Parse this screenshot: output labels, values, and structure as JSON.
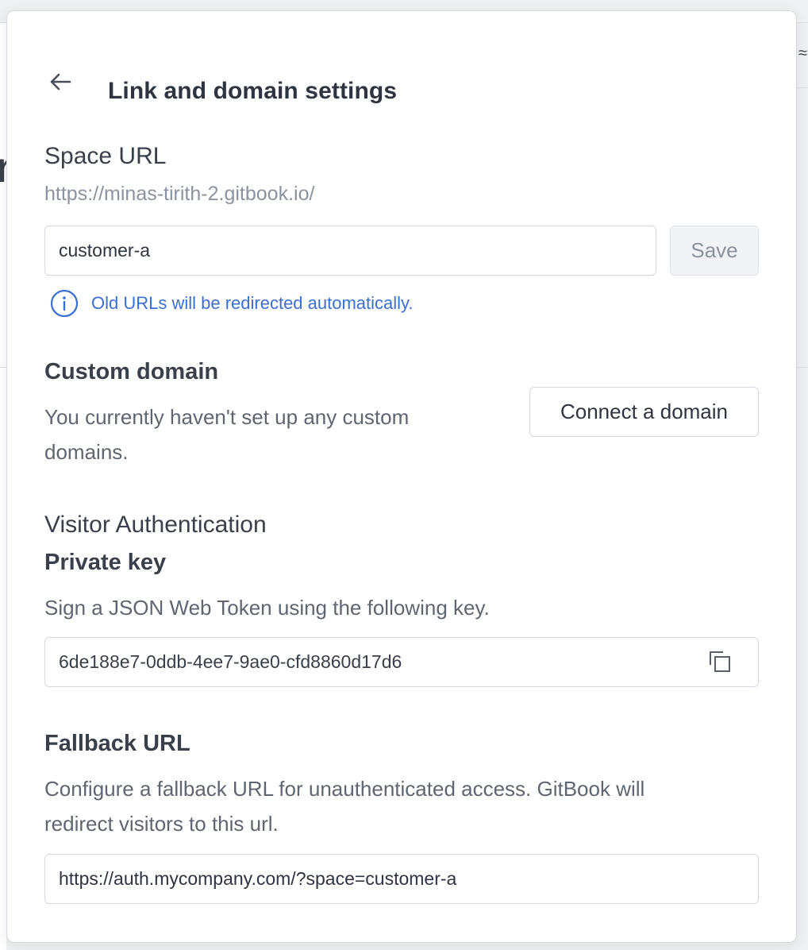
{
  "panel": {
    "title": "Link and domain settings",
    "back_icon": "arrow-left-icon"
  },
  "space_url": {
    "heading": "Space URL",
    "base_url": "https://minas-tirith-2.gitbook.io/",
    "slug_value": "customer-a",
    "save_label": "Save",
    "hint_icon": "info-circle-icon",
    "hint_text": "Old URLs will be redirected automatically."
  },
  "custom_domain": {
    "heading": "Custom domain",
    "description_line1": "You currently haven't set up any custom",
    "description_line2": "domains.",
    "connect_label": "Connect a domain"
  },
  "visitor_auth": {
    "heading": "Visitor Authentication",
    "private_key": {
      "heading": "Private key",
      "description": "Sign a JSON Web Token using the following key.",
      "value": "6de188e7-0ddb-4ee7-9ae0-cfd8860d17d6",
      "copy_icon": "copy-icon"
    },
    "fallback": {
      "heading": "Fallback URL",
      "description_line1": "Configure a fallback URL for unauthenticated access. GitBook will",
      "description_line2": "redirect visitors to this url.",
      "value": "https://auth.mycompany.com/?space=customer-a"
    }
  },
  "colors": {
    "accent_blue": "#3b6fd0",
    "text_primary": "#2e3440",
    "text_muted": "#5f6670",
    "border": "#d5d9df"
  }
}
